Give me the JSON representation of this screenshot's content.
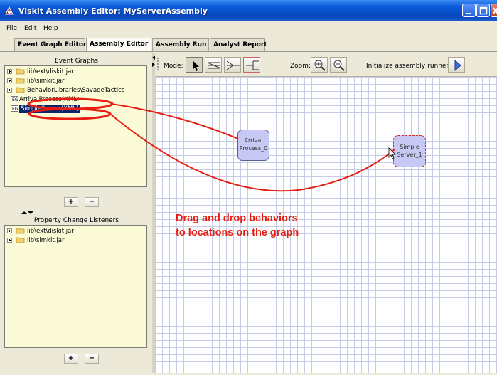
{
  "window": {
    "title": "Viskit Assembly Editor: MyServerAssembly"
  },
  "menu": {
    "file": {
      "u": "F",
      "rest": "ile"
    },
    "edit": {
      "u": "E",
      "rest": "dit"
    },
    "help": {
      "u": "H",
      "rest": "elp"
    }
  },
  "tabs": [
    {
      "label": "Event Graph Editor",
      "active": false
    },
    {
      "label": "Assembly Editor",
      "active": true
    },
    {
      "label": "Assembly Run",
      "active": false
    },
    {
      "label": "Analyst Report",
      "active": false
    }
  ],
  "event_graphs": {
    "title": "Event Graphs",
    "items": [
      {
        "label": "lib\\ext\\diskit.jar",
        "type": "folder"
      },
      {
        "label": "lib\\simkit.jar",
        "type": "folder"
      },
      {
        "label": "BehaviorLibraries\\SavageTactics",
        "type": "folder"
      },
      {
        "label": "ArrivalProcess(XML)",
        "type": "leaf"
      },
      {
        "label": "SimpleServer(XML)",
        "type": "leaf",
        "selected": true
      }
    ],
    "add_label": "+",
    "remove_label": "−"
  },
  "pcl": {
    "title": "Property Change Listeners",
    "items": [
      {
        "label": "lib\\ext\\diskit.jar",
        "type": "folder"
      },
      {
        "label": "lib\\simkit.jar",
        "type": "folder"
      }
    ],
    "add_label": "+",
    "remove_label": "−"
  },
  "toolbar": {
    "mode_label": "Mode:",
    "zoom_label": "Zoom:",
    "init_label": "Initialize assembly runner:"
  },
  "canvas": {
    "nodes": [
      {
        "name": "arrival",
        "line1": "Arrival",
        "line2": "Process_0"
      },
      {
        "name": "simple",
        "line1": "Simple",
        "line2": "Server_1"
      }
    ],
    "annotation": {
      "line1": "Drag and drop behaviors",
      "line2": "to locations on the graph",
      "color": "#e61d12"
    }
  },
  "colors": {
    "titlebar": "#0a5bd9",
    "tree_bg": "#fcfbd7",
    "node_fill": "#c7c8f3",
    "grid": "#c6cbe6",
    "selection": "#0b246a"
  }
}
